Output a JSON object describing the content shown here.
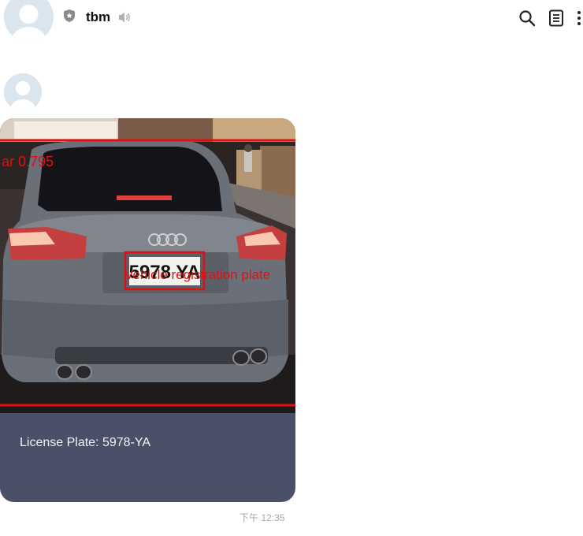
{
  "header": {
    "title": "tbm"
  },
  "message": {
    "detection_score_label": "ar 0.795",
    "detection_class_label": "Vehicle registration plate",
    "plate_text": "5978 YA",
    "caption": "License Plate: 5978-YA",
    "time": "下午 12:35"
  },
  "colors": {
    "bubble": "#4a5068",
    "annotation": "#e01010",
    "background": "#ffffff"
  }
}
